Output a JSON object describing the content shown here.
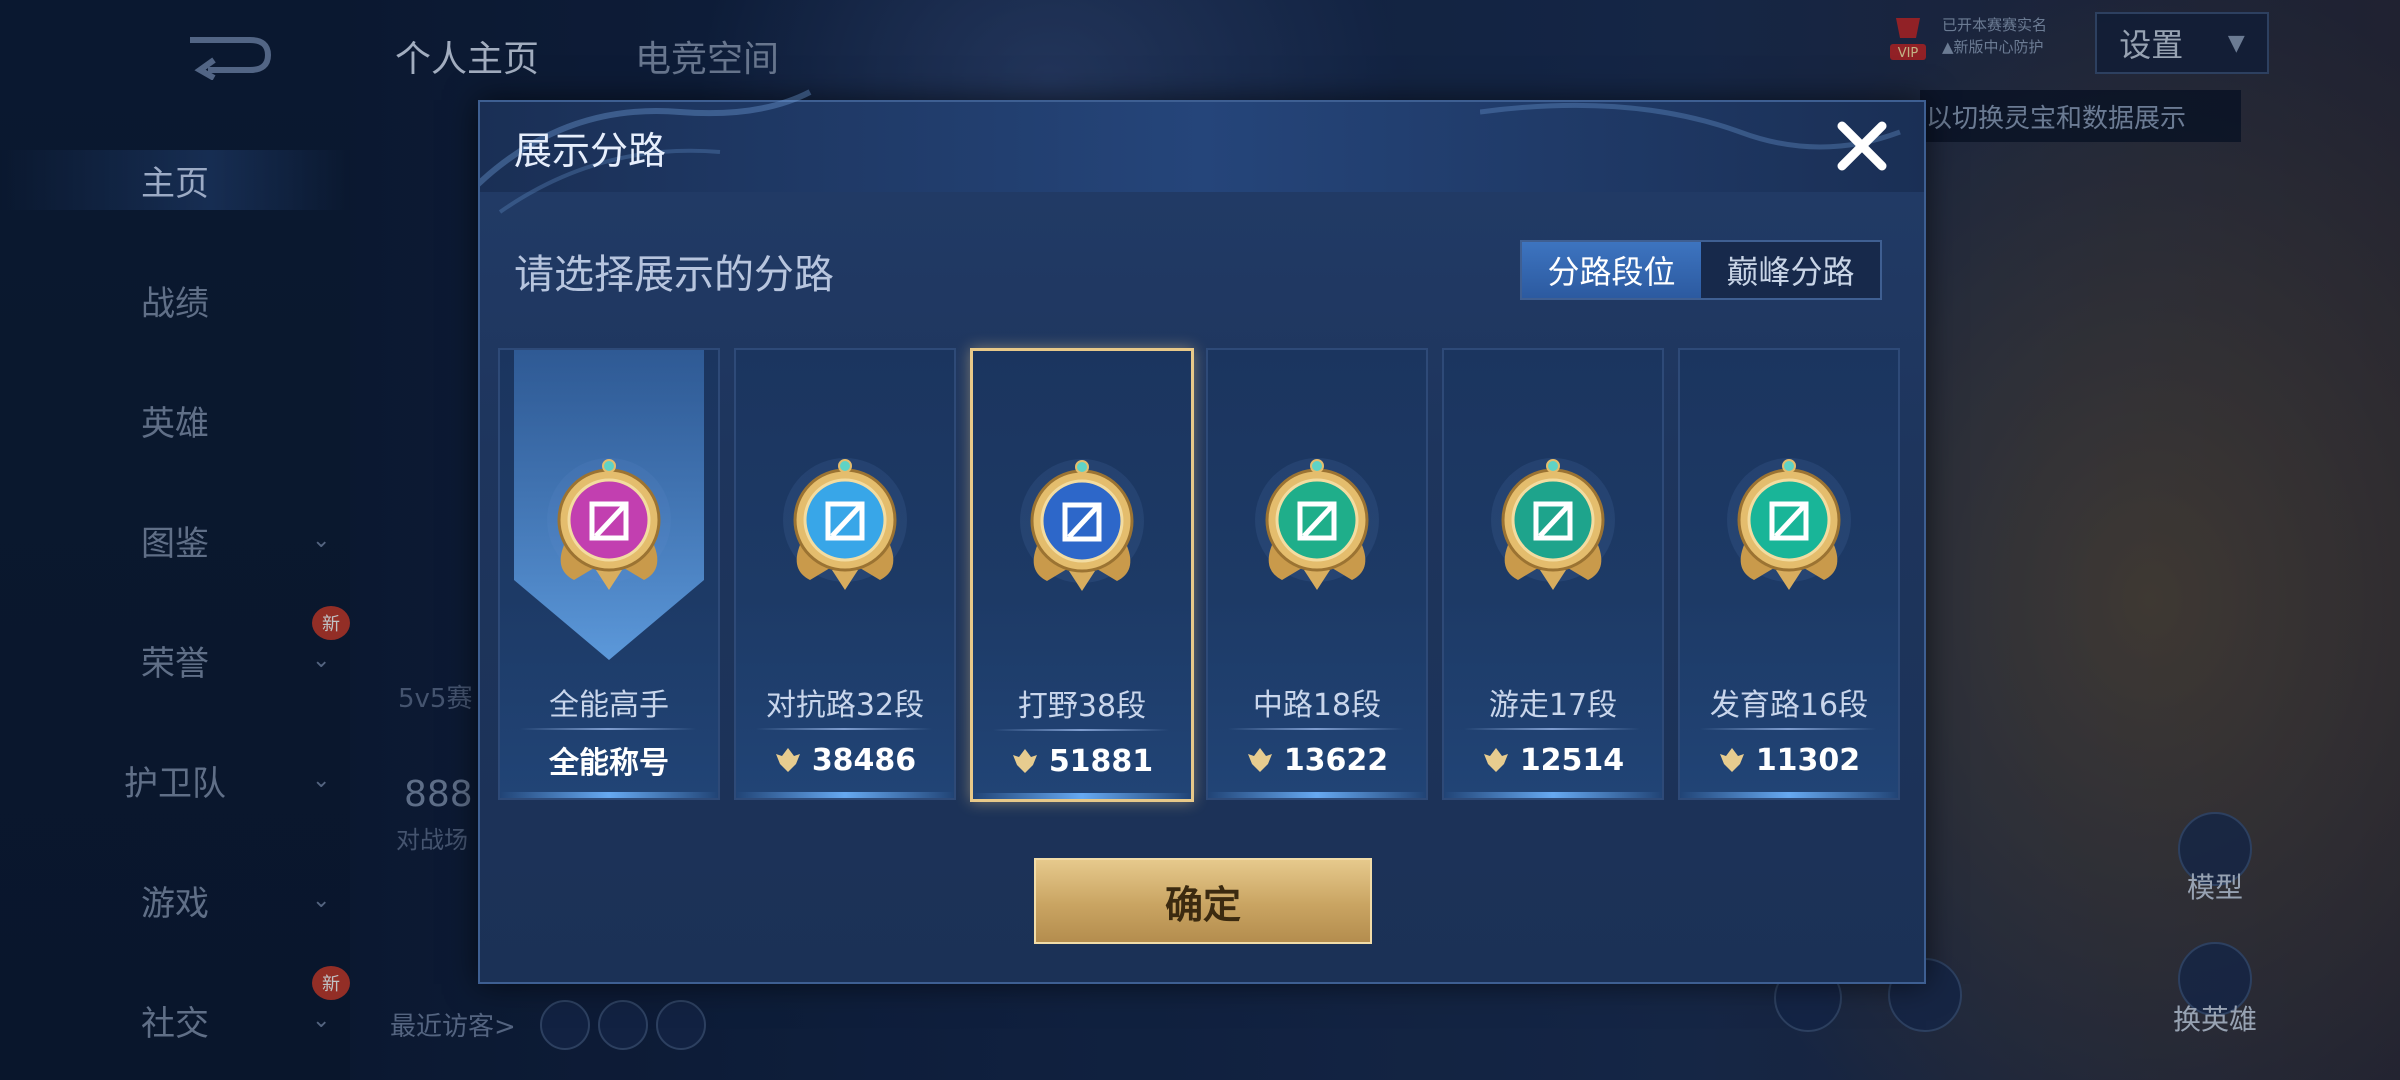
{
  "background": {
    "top_tabs": [
      {
        "label": "个人主页",
        "active": true
      },
      {
        "label": "电竞空间",
        "active": false
      }
    ],
    "settings_label": "设置",
    "vip_label": "VIP",
    "vip_notice_line1": "已开本赛赛实名",
    "vip_notice_line2": "▲新版中心防护",
    "hint_text": "以切换灵宝和数据展示",
    "ghost_texts": {
      "left_mode": "5v5赛",
      "left_number": "888",
      "left_caption": "对战场",
      "recent_visitors": "最近访客>"
    },
    "right_buttons": {
      "model": "模型",
      "switch_hero": "换英雄"
    }
  },
  "sidebar": {
    "items": [
      {
        "label": "主页",
        "active": true,
        "chevron": false,
        "badge": ""
      },
      {
        "label": "战绩",
        "active": false,
        "chevron": false,
        "badge": ""
      },
      {
        "label": "英雄",
        "active": false,
        "chevron": false,
        "badge": ""
      },
      {
        "label": "图鉴",
        "active": false,
        "chevron": true,
        "badge": ""
      },
      {
        "label": "荣誉",
        "active": false,
        "chevron": true,
        "badge": "新"
      },
      {
        "label": "护卫队",
        "active": false,
        "chevron": true,
        "badge": ""
      },
      {
        "label": "游戏",
        "active": false,
        "chevron": true,
        "badge": ""
      },
      {
        "label": "社交",
        "active": false,
        "chevron": true,
        "badge": "新"
      }
    ]
  },
  "modal": {
    "title": "展示分路",
    "subtitle": "请选择展示的分路",
    "segment": {
      "options": [
        "分路段位",
        "巅峰分路"
      ],
      "selected_index": 0
    },
    "cards": [
      {
        "name": "全能高手",
        "value": "全能称号",
        "has_value_icon": false,
        "selected": false,
        "emblem": "all-round-emblem-icon",
        "color": "#c23fb0"
      },
      {
        "name": "对抗路32段",
        "value": "38486",
        "has_value_icon": true,
        "selected": false,
        "emblem": "clash-lane-emblem-icon",
        "color": "#38a6e8"
      },
      {
        "name": "打野38段",
        "value": "51881",
        "has_value_icon": true,
        "selected": true,
        "emblem": "jungle-emblem-icon",
        "color": "#2d67c9"
      },
      {
        "name": "中路18段",
        "value": "13622",
        "has_value_icon": true,
        "selected": false,
        "emblem": "mid-lane-emblem-icon",
        "color": "#1fae8a"
      },
      {
        "name": "游走17段",
        "value": "12514",
        "has_value_icon": true,
        "selected": false,
        "emblem": "roam-emblem-icon",
        "color": "#1ea48c"
      },
      {
        "name": "发育路16段",
        "value": "11302",
        "has_value_icon": true,
        "selected": false,
        "emblem": "farm-lane-emblem-icon",
        "color": "#19b598"
      }
    ],
    "confirm_label": "确定"
  },
  "colors": {
    "gold": "#e8c989",
    "modal_bg": "#1e355d",
    "accent_blue": "#3d74c0"
  }
}
